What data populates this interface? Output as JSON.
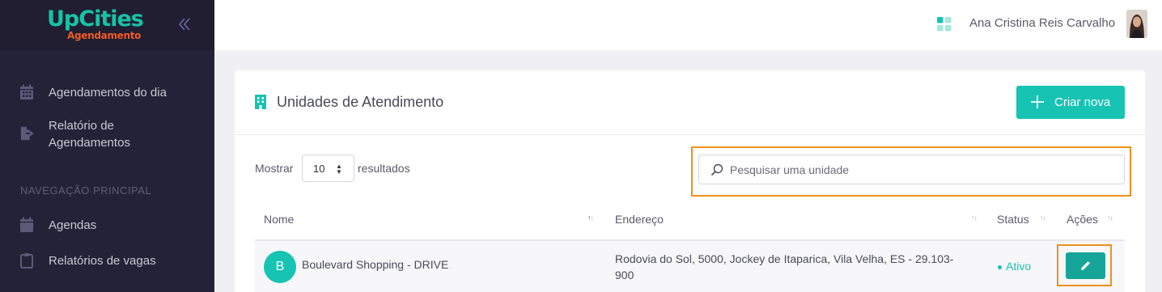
{
  "brand": {
    "name": "UpCities",
    "subtitle": "Agendamento"
  },
  "sidebar": {
    "items_top": [
      {
        "label": "Agendamentos do dia",
        "icon": "calendar-grid-icon"
      },
      {
        "label": "Relatório de Agendamentos",
        "icon": "file-export-icon"
      }
    ],
    "section_title": "NAVEGAÇÃO PRINCIPAL",
    "items_main": [
      {
        "label": "Agendas",
        "icon": "calendar-icon"
      },
      {
        "label": "Relatórios de vagas",
        "icon": "clipboard-icon"
      }
    ]
  },
  "topbar": {
    "user_name": "Ana Cristina Reis Carvalho",
    "apps_icon": "apps-grid-icon"
  },
  "card": {
    "title": "Unidades de Atendimento",
    "new_button": "Criar nova",
    "show_label": "Mostrar",
    "page_size": "10",
    "results_label": "resultados",
    "search_placeholder": "Pesquisar uma unidade",
    "columns": {
      "name": "Nome",
      "address": "Endereço",
      "status": "Status",
      "actions": "Ações"
    },
    "rows": [
      {
        "initial": "B",
        "name": "Boulevard Shopping - DRIVE",
        "address": "Rodovia do Sol, 5000, Jockey de Itaparica, Vila Velha, ES - 29.103-900",
        "status": "Ativo"
      }
    ]
  },
  "colors": {
    "accent": "#17c3b2",
    "sidebar": "#242236",
    "highlight": "#f0901e",
    "logo_orange": "#f05a28"
  }
}
